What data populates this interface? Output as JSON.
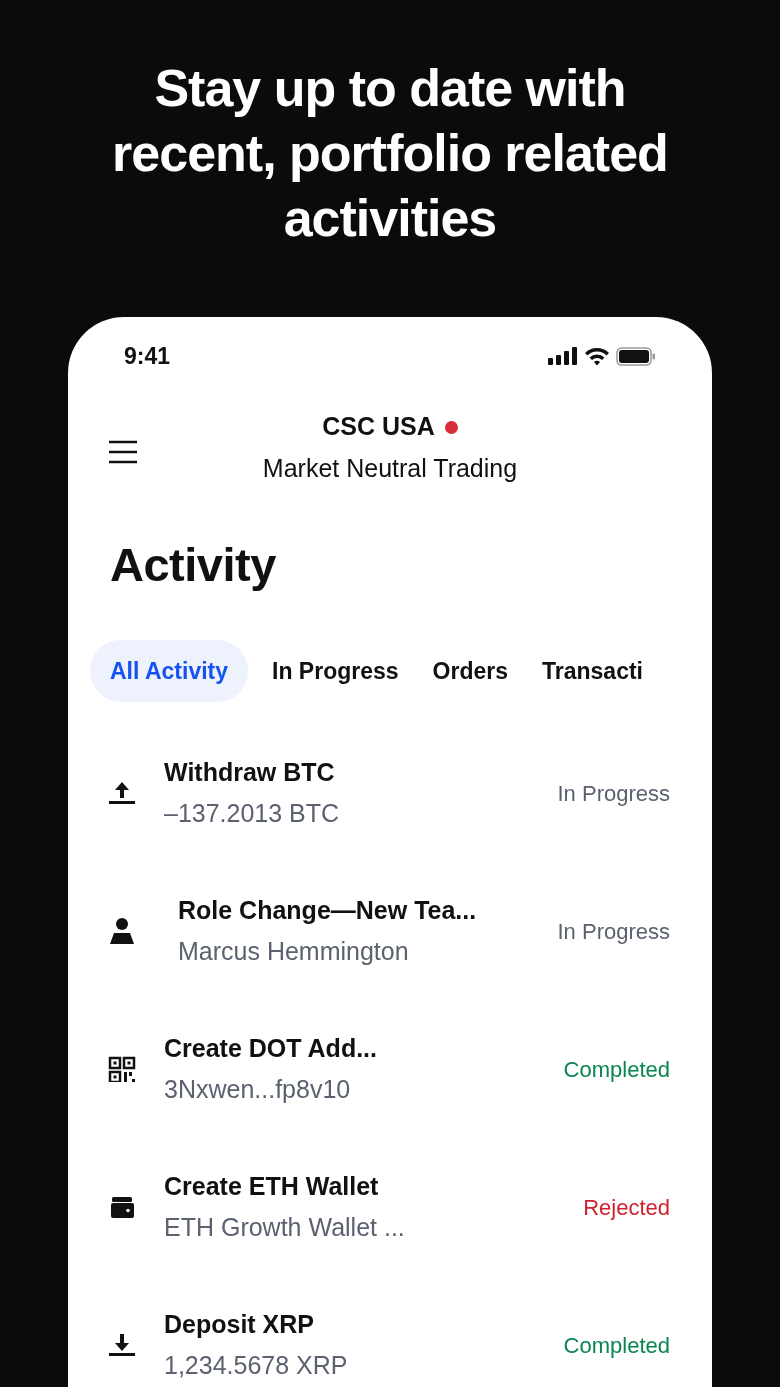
{
  "headline": "Stay up to date with recent, portfolio related activities",
  "status_bar": {
    "time": "9:41"
  },
  "header": {
    "title": "CSC USA",
    "subtitle": "Market Neutral Trading",
    "live_dot": {
      "color": "#d92d3a"
    }
  },
  "page_title": "Activity",
  "tabs": [
    {
      "label": "All Activity",
      "selected": true
    },
    {
      "label": "In Progress",
      "selected": false
    },
    {
      "label": "Orders",
      "selected": false
    },
    {
      "label": "Transacti",
      "selected": false
    }
  ],
  "activities": [
    {
      "kind": "withdraw",
      "title": "Withdraw BTC",
      "detail": "–137.2013 BTC",
      "status": "In Progress",
      "color": "#5b616e"
    },
    {
      "kind": "role",
      "title": "Role Change—New Tea...",
      "detail": "Marcus Hemmington",
      "status": "In Progress",
      "color": "#5b616e"
    },
    {
      "kind": "address",
      "title": "Create DOT Add...",
      "detail": "3Nxwen...fp8v10",
      "status": "Completed",
      "color": "#098551"
    },
    {
      "kind": "wallet",
      "title": "Create ETH Wallet",
      "detail": "ETH Growth Wallet ...",
      "status": "Rejected",
      "color": "#cf202f"
    },
    {
      "kind": "deposit",
      "title": "Deposit XRP",
      "detail": "1,234.5678 XRP",
      "status": "Completed",
      "color": "#098551"
    }
  ]
}
